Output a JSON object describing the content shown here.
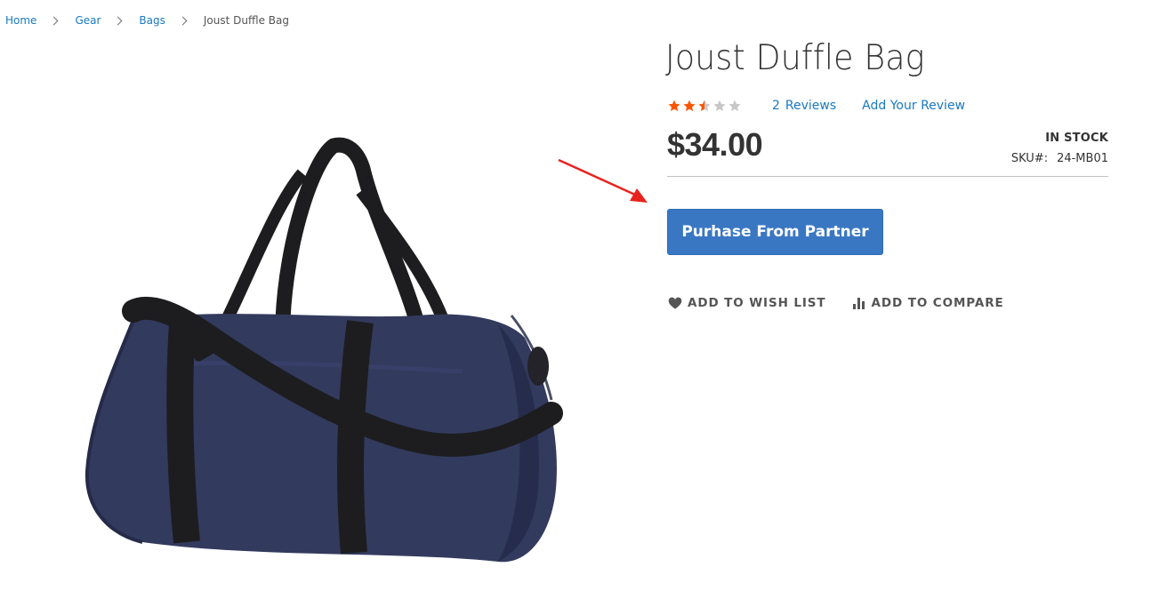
{
  "breadcrumbs": {
    "items": [
      "Home",
      "Gear",
      "Bags"
    ],
    "current": "Joust Duffle Bag"
  },
  "product": {
    "title": "Joust Duffle Bag",
    "rating": {
      "value": 2.5,
      "max": 5,
      "reviews_count": "2",
      "reviews_label": "Reviews",
      "add_review_label": "Add Your Review"
    },
    "price": "$34.00",
    "stock_status": "IN STOCK",
    "sku_label": "SKU#:",
    "sku_value": "24-MB01",
    "purchase_button": "Purhase From Partner",
    "wishlist_label": "ADD TO WISH LIST",
    "compare_label": "ADD TO COMPARE"
  },
  "colors": {
    "link": "#1979c3",
    "star_filled": "#ff5501",
    "star_empty": "#c7c7c7",
    "button": "#3a77c3",
    "annotation_arrow": "#e8231e",
    "bag_body": "#323a5e",
    "bag_strap": "#1d1d1f"
  },
  "icons": {
    "wishlist": "heart-icon",
    "compare": "bar-chart-icon",
    "breadcrumb_separator": "chevron-right-icon"
  }
}
